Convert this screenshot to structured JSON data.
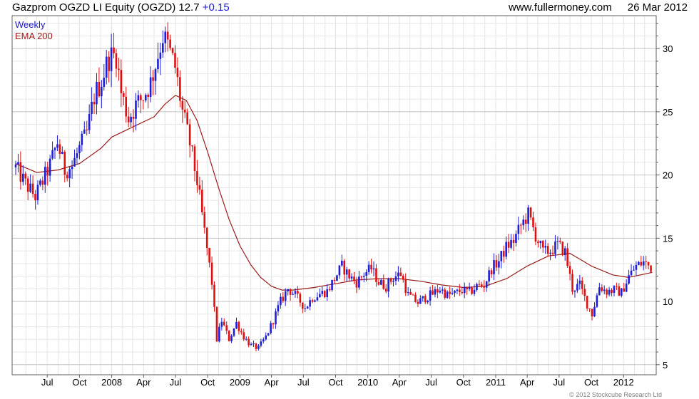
{
  "header": {
    "title": "Gazprom OGZD LI Equity (OGZD) 12.7",
    "change": "+0.15",
    "website": "www.fullermoney.com",
    "date": "26 Mar 2012"
  },
  "copyright": "© 2012 Stockcube Research Ltd",
  "colors": {
    "up_candle": "#1e1ed6",
    "down_candle": "#e01010",
    "ema_line": "#9b1c1c",
    "grid": "#d2d2d2",
    "frame": "#606060"
  },
  "chart_data": {
    "type": "line",
    "title": "Gazprom OGZD LI Equity (OGZD)",
    "xlabel": "",
    "ylabel": "",
    "ylim": [
      4.2,
      32.6
    ],
    "grid": true,
    "legend_placement": "top-left",
    "y_ticks": [
      5,
      10,
      15,
      20,
      25,
      30
    ],
    "x_ticks": [
      {
        "label": "Jul",
        "date": "2007-07-01"
      },
      {
        "label": "Oct",
        "date": "2007-10-01"
      },
      {
        "label": "2008",
        "date": "2008-01-01"
      },
      {
        "label": "Apr",
        "date": "2008-04-01"
      },
      {
        "label": "Jul",
        "date": "2008-07-01"
      },
      {
        "label": "Oct",
        "date": "2008-10-01"
      },
      {
        "label": "2009",
        "date": "2009-01-01"
      },
      {
        "label": "Apr",
        "date": "2009-04-01"
      },
      {
        "label": "Jul",
        "date": "2009-07-01"
      },
      {
        "label": "Oct",
        "date": "2009-10-01"
      },
      {
        "label": "2010",
        "date": "2010-01-01"
      },
      {
        "label": "Apr",
        "date": "2010-04-01"
      },
      {
        "label": "Jul",
        "date": "2010-07-01"
      },
      {
        "label": "Oct",
        "date": "2010-10-01"
      },
      {
        "label": "2011",
        "date": "2011-01-01"
      },
      {
        "label": "Apr",
        "date": "2011-04-01"
      },
      {
        "label": "Jul",
        "date": "2011-07-01"
      },
      {
        "label": "Oct",
        "date": "2011-10-01"
      },
      {
        "label": "2012",
        "date": "2012-01-01"
      }
    ],
    "series": [
      {
        "name": "Weekly",
        "style": "candlestick",
        "points": [
          [
            "2007-04-02",
            20.6
          ],
          [
            "2007-04-30",
            19.3
          ],
          [
            "2007-05-28",
            18.3
          ],
          [
            "2007-06-18",
            19.5
          ],
          [
            "2007-07-09",
            20.8
          ],
          [
            "2007-07-30",
            22.6
          ],
          [
            "2007-08-20",
            20.4
          ],
          [
            "2007-09-10",
            20.7
          ],
          [
            "2007-10-01",
            22.1
          ],
          [
            "2007-10-22",
            23.3
          ],
          [
            "2007-11-12",
            26.2
          ],
          [
            "2007-12-03",
            27.5
          ],
          [
            "2007-12-24",
            29.3
          ],
          [
            "2008-01-14",
            29.5
          ],
          [
            "2008-01-28",
            26.5
          ],
          [
            "2008-02-18",
            24.5
          ],
          [
            "2008-03-10",
            25.5
          ],
          [
            "2008-03-31",
            26.2
          ],
          [
            "2008-04-21",
            27.3
          ],
          [
            "2008-05-12",
            29.5
          ],
          [
            "2008-05-26",
            31.0
          ],
          [
            "2008-06-09",
            30.2
          ],
          [
            "2008-06-30",
            28.5
          ],
          [
            "2008-07-21",
            25.0
          ],
          [
            "2008-08-11",
            22.5
          ],
          [
            "2008-09-01",
            19.5
          ],
          [
            "2008-09-22",
            15.5
          ],
          [
            "2008-10-13",
            11.5
          ],
          [
            "2008-10-27",
            7.0
          ],
          [
            "2008-11-10",
            8.5
          ],
          [
            "2008-12-01",
            7.0
          ],
          [
            "2008-12-22",
            8.3
          ],
          [
            "2009-01-12",
            7.2
          ],
          [
            "2009-02-02",
            6.5
          ],
          [
            "2009-02-23",
            6.3
          ],
          [
            "2009-03-16",
            7.2
          ],
          [
            "2009-04-06",
            8.5
          ],
          [
            "2009-04-27",
            10.0
          ],
          [
            "2009-05-18",
            11.0
          ],
          [
            "2009-06-08",
            10.5
          ],
          [
            "2009-07-06",
            9.5
          ],
          [
            "2009-07-27",
            10.3
          ],
          [
            "2009-08-17",
            10.6
          ],
          [
            "2009-09-07",
            10.8
          ],
          [
            "2009-09-28",
            11.8
          ],
          [
            "2009-10-19",
            12.8
          ],
          [
            "2009-11-09",
            12.0
          ],
          [
            "2009-11-30",
            11.5
          ],
          [
            "2009-12-21",
            12.2
          ],
          [
            "2010-01-11",
            12.6
          ],
          [
            "2010-02-01",
            11.5
          ],
          [
            "2010-02-22",
            11.2
          ],
          [
            "2010-03-15",
            11.9
          ],
          [
            "2010-04-05",
            12.2
          ],
          [
            "2010-04-26",
            10.5
          ],
          [
            "2010-05-24",
            9.9
          ],
          [
            "2010-06-14",
            10.3
          ],
          [
            "2010-07-05",
            10.6
          ],
          [
            "2010-07-26",
            11.0
          ],
          [
            "2010-08-16",
            10.5
          ],
          [
            "2010-09-06",
            10.6
          ],
          [
            "2010-09-27",
            10.9
          ],
          [
            "2010-10-18",
            10.7
          ],
          [
            "2010-11-08",
            11.2
          ],
          [
            "2010-11-29",
            11.3
          ],
          [
            "2010-12-20",
            12.6
          ],
          [
            "2011-01-10",
            13.2
          ],
          [
            "2011-01-31",
            14.3
          ],
          [
            "2011-02-21",
            14.8
          ],
          [
            "2011-03-14",
            16.0
          ],
          [
            "2011-04-04",
            16.9
          ],
          [
            "2011-04-25",
            15.2
          ],
          [
            "2011-05-16",
            13.9
          ],
          [
            "2011-06-06",
            14.0
          ],
          [
            "2011-06-27",
            14.5
          ],
          [
            "2011-07-18",
            13.9
          ],
          [
            "2011-08-08",
            11.0
          ],
          [
            "2011-08-29",
            11.3
          ],
          [
            "2011-09-19",
            9.8
          ],
          [
            "2011-10-03",
            9.0
          ],
          [
            "2011-10-24",
            11.2
          ],
          [
            "2011-11-14",
            10.8
          ],
          [
            "2011-12-05",
            10.9
          ],
          [
            "2011-12-26",
            10.7
          ],
          [
            "2012-01-16",
            12.0
          ],
          [
            "2012-02-06",
            12.8
          ],
          [
            "2012-02-27",
            13.1
          ],
          [
            "2012-03-19",
            12.7
          ]
        ]
      },
      {
        "name": "EMA 200",
        "style": "line",
        "points": [
          [
            "2007-04-02",
            20.9
          ],
          [
            "2007-06-01",
            20.2
          ],
          [
            "2007-08-01",
            20.4
          ],
          [
            "2007-10-01",
            20.9
          ],
          [
            "2007-12-01",
            22.1
          ],
          [
            "2008-01-01",
            23.0
          ],
          [
            "2008-03-01",
            23.8
          ],
          [
            "2008-05-01",
            24.6
          ],
          [
            "2008-06-01",
            25.6
          ],
          [
            "2008-07-01",
            26.3
          ],
          [
            "2008-08-01",
            25.9
          ],
          [
            "2008-09-01",
            24.3
          ],
          [
            "2008-10-01",
            21.8
          ],
          [
            "2008-11-01",
            19.0
          ],
          [
            "2008-12-01",
            16.5
          ],
          [
            "2009-01-01",
            14.4
          ],
          [
            "2009-02-01",
            12.9
          ],
          [
            "2009-03-01",
            11.9
          ],
          [
            "2009-04-01",
            11.2
          ],
          [
            "2009-05-01",
            10.9
          ],
          [
            "2009-06-01",
            10.9
          ],
          [
            "2009-08-01",
            11.1
          ],
          [
            "2009-10-01",
            11.4
          ],
          [
            "2009-12-01",
            11.7
          ],
          [
            "2010-02-01",
            11.8
          ],
          [
            "2010-04-01",
            11.8
          ],
          [
            "2010-06-01",
            11.6
          ],
          [
            "2010-08-01",
            11.3
          ],
          [
            "2010-10-01",
            11.1
          ],
          [
            "2010-12-01",
            11.2
          ],
          [
            "2011-02-01",
            11.8
          ],
          [
            "2011-04-01",
            12.8
          ],
          [
            "2011-06-01",
            13.6
          ],
          [
            "2011-08-01",
            13.8
          ],
          [
            "2011-09-01",
            13.3
          ],
          [
            "2011-10-01",
            12.8
          ],
          [
            "2011-12-01",
            12.1
          ],
          [
            "2012-01-15",
            11.9
          ],
          [
            "2012-03-23",
            12.3
          ]
        ]
      }
    ],
    "legend": [
      "Weekly",
      "EMA 200"
    ]
  }
}
